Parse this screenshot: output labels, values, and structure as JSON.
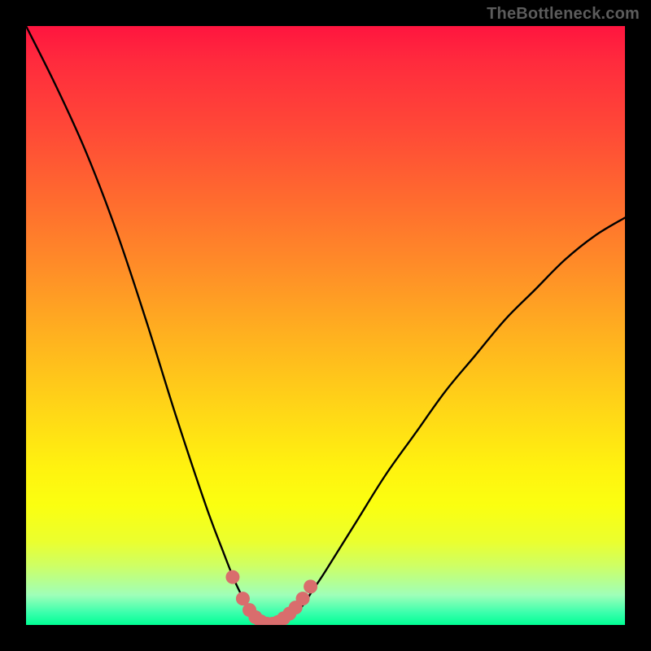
{
  "watermark": "TheBottleneck.com",
  "chart_data": {
    "type": "line",
    "title": "",
    "xlabel": "",
    "ylabel": "",
    "xlim": [
      0,
      100
    ],
    "ylim": [
      0,
      100
    ],
    "grid": false,
    "legend": false,
    "series": [
      {
        "name": "bottleneck-curve",
        "x": [
          0,
          5,
          10,
          15,
          20,
          25,
          30,
          33,
          35,
          37,
          38,
          39,
          40,
          41,
          42,
          43,
          44,
          46,
          48,
          50,
          55,
          60,
          65,
          70,
          75,
          80,
          85,
          90,
          95,
          100
        ],
        "values": [
          100,
          90,
          79,
          66,
          51,
          35,
          20,
          12,
          7,
          3,
          1,
          0.3,
          0,
          0,
          0,
          0.4,
          1,
          3,
          6,
          9,
          17,
          25,
          32,
          39,
          45,
          51,
          56,
          61,
          65,
          68
        ]
      }
    ],
    "markers": {
      "name": "bottom-dots",
      "color": "#d96d6d",
      "x": [
        34.5,
        36.2,
        37.3,
        38.3,
        39.2,
        40.2,
        41.2,
        42.1,
        43.0,
        44.0,
        45.0,
        46.2,
        47.5
      ],
      "values": [
        8.0,
        4.4,
        2.5,
        1.3,
        0.6,
        0.2,
        0.2,
        0.5,
        1.1,
        1.9,
        2.9,
        4.4,
        6.4
      ]
    },
    "background": {
      "type": "vertical-gradient",
      "stops": [
        {
          "pos": 0,
          "color": "#ff153f"
        },
        {
          "pos": 30,
          "color": "#ff6e2e"
        },
        {
          "pos": 64,
          "color": "#ffd617"
        },
        {
          "pos": 86,
          "color": "#ebff2e"
        },
        {
          "pos": 100,
          "color": "#00ff94"
        }
      ]
    }
  }
}
